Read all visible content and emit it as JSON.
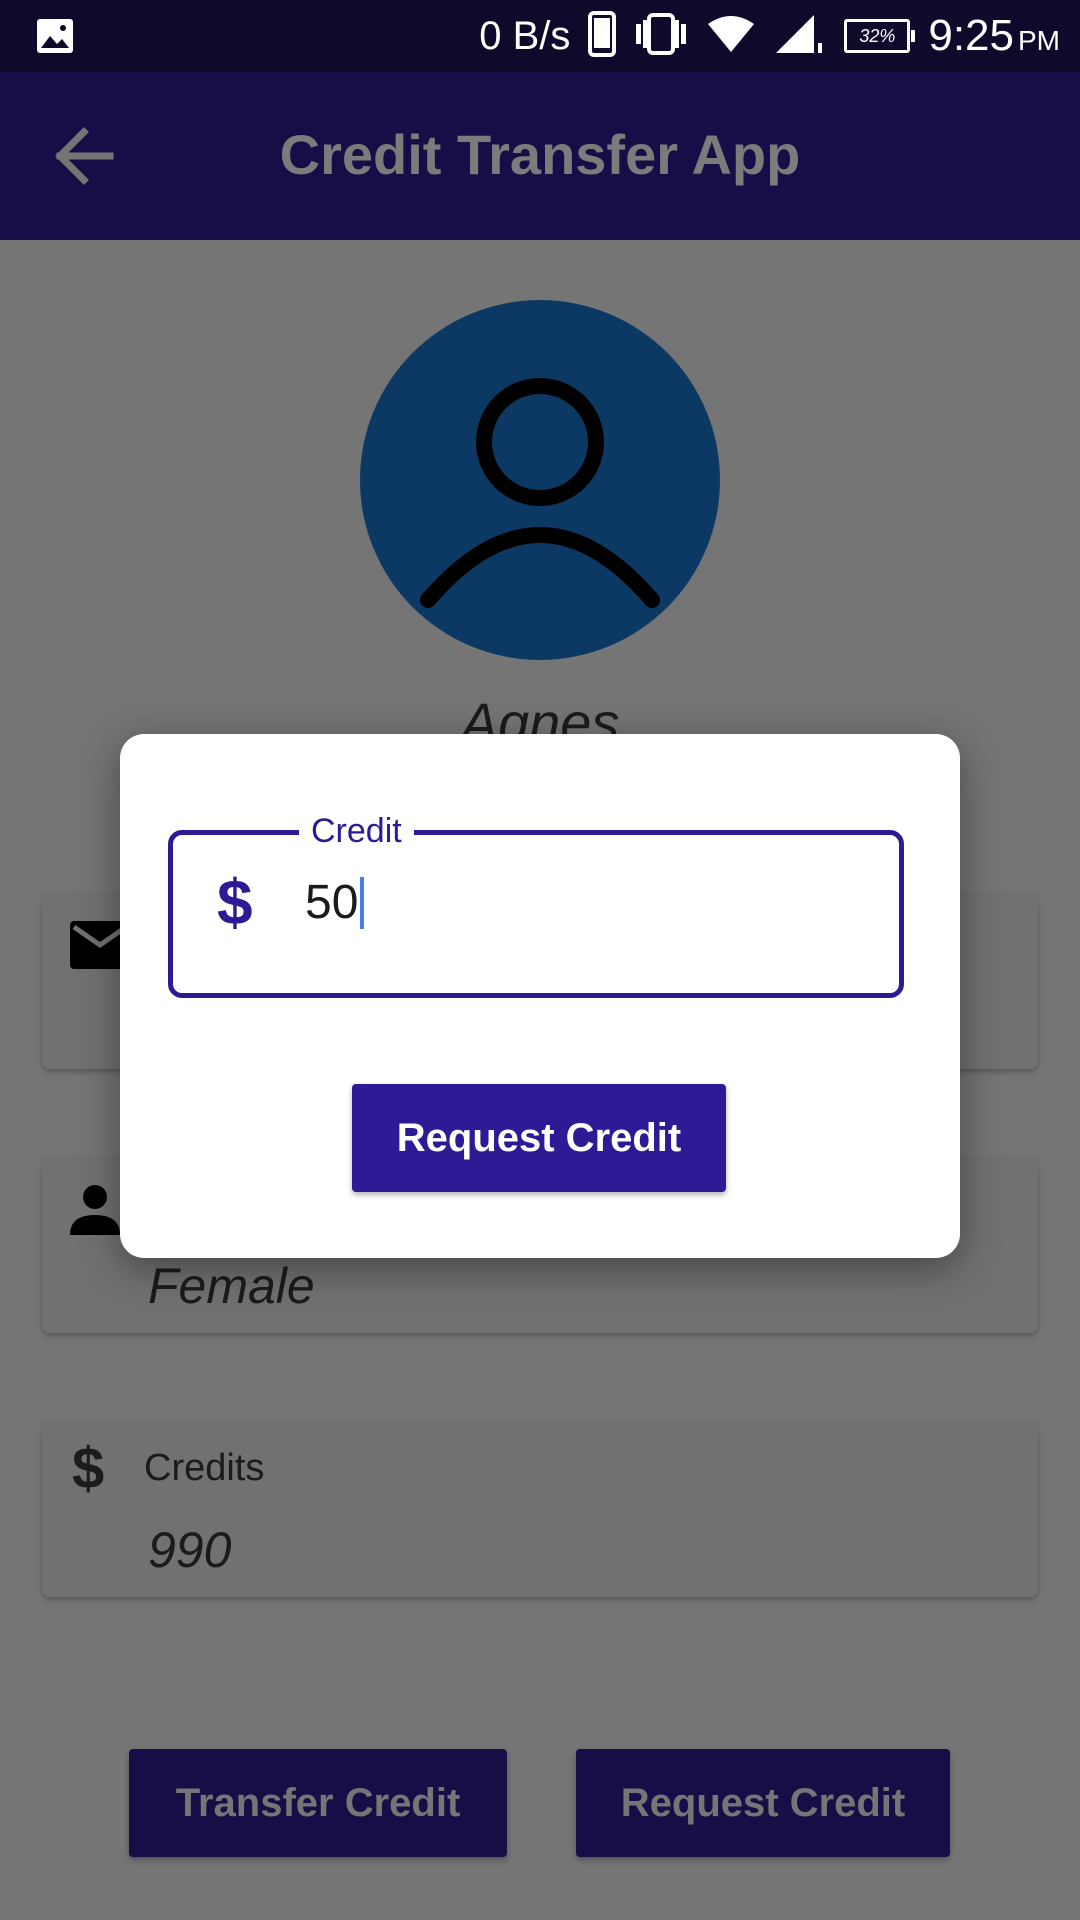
{
  "status_bar": {
    "network_speed": "0 B/s",
    "battery_percent": "32%",
    "time": "9:25",
    "ampm": "PM",
    "icons": [
      "image-icon",
      "phone-icon",
      "vibrate-icon",
      "wifi-icon",
      "signal-icon",
      "battery-icon"
    ]
  },
  "app_bar": {
    "title": "Credit Transfer App",
    "back_icon": "arrow-left-icon"
  },
  "profile": {
    "name": "Agnes",
    "avatar_icon": "person-outline-icon",
    "avatar_color": "#0b3964"
  },
  "cards": [
    {
      "icon": "email-icon",
      "label": "",
      "value": ""
    },
    {
      "icon": "person-icon",
      "label": "",
      "value": "Female"
    },
    {
      "icon": "dollar-icon",
      "label": "Credits",
      "value": "990"
    }
  ],
  "buttons": {
    "transfer": "Transfer Credit",
    "request": "Request Credit"
  },
  "dialog": {
    "field_label": "Credit",
    "field_prefix": "$",
    "field_value": "50",
    "submit_label": "Request Credit"
  },
  "colors": {
    "primary": "#2e1a94",
    "app_bar": "#160e47",
    "scrim": "#757575"
  }
}
